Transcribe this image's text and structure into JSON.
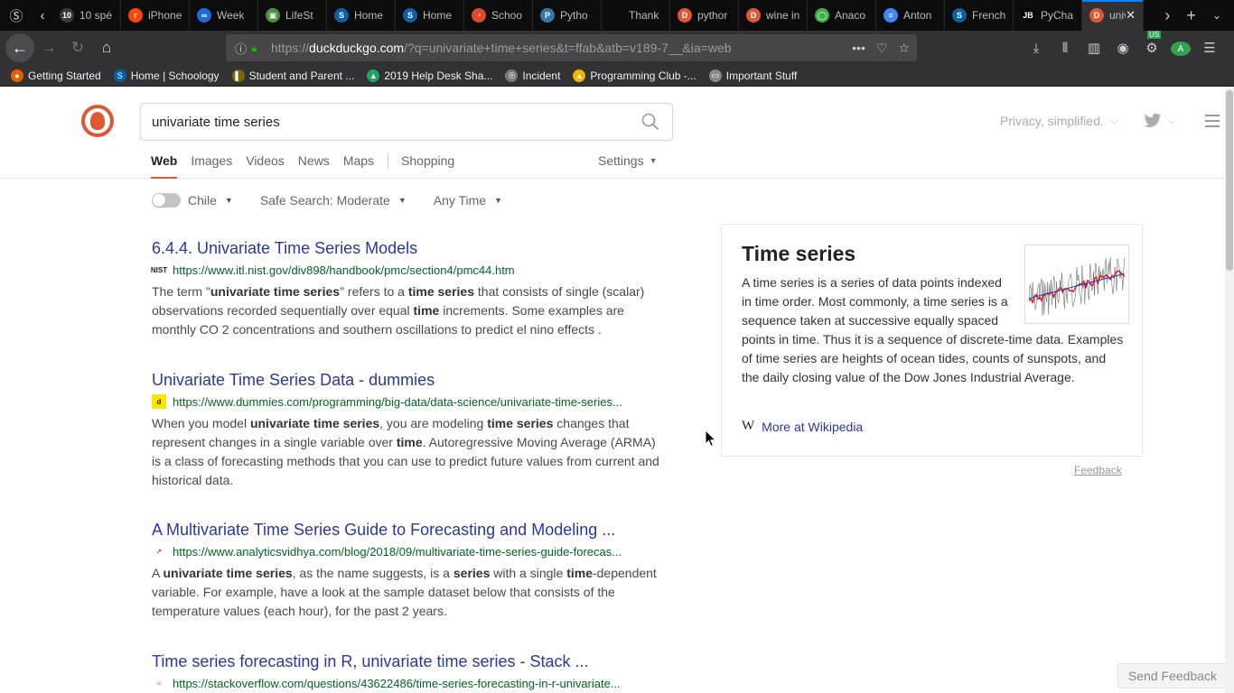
{
  "browser": {
    "tabs": [
      {
        "title": "10 spé",
        "color": "#3a3a3a",
        "glyph": "10"
      },
      {
        "title": "iPhone",
        "color": "#ff4500",
        "glyph": "r"
      },
      {
        "title": "Week",
        "color": "#1e6bd6",
        "glyph": "∞"
      },
      {
        "title": "LifeSt",
        "color": "#4a8f3a",
        "glyph": "▣"
      },
      {
        "title": "Home",
        "color": "#0b5fa5",
        "glyph": "S"
      },
      {
        "title": "Home",
        "color": "#0b5fa5",
        "glyph": "S"
      },
      {
        "title": "Schoo",
        "color": "#e0492c",
        "glyph": "◔"
      },
      {
        "title": "Pytho",
        "color": "#3776ab",
        "glyph": "P"
      },
      {
        "title": "Thank",
        "color": "#0c0c0d",
        "glyph": ""
      },
      {
        "title": "pythor",
        "color": "#de5833",
        "glyph": "D"
      },
      {
        "title": "wine in",
        "color": "#de5833",
        "glyph": "D"
      },
      {
        "title": "Anaco",
        "color": "#3eb049",
        "glyph": "◯"
      },
      {
        "title": "Anton",
        "color": "#4285f4",
        "glyph": "≡"
      },
      {
        "title": "French",
        "color": "#0b5fa5",
        "glyph": "S"
      },
      {
        "title": "PyCha",
        "color": "#000000",
        "glyph": "JB"
      }
    ],
    "active_tab": {
      "title": "univ",
      "color": "#de5833",
      "glyph": "D"
    },
    "url_prefix": "https://",
    "url_host": "duckduckgo.com",
    "url_rest": "/?q=univariate+time+series&t=ffab&atb=v189-7__&ia=web",
    "bookmarks": [
      {
        "label": "Getting Started",
        "color": "#e66000",
        "glyph": "●"
      },
      {
        "label": "Home | Schoology",
        "color": "#0b5fa5",
        "glyph": "S"
      },
      {
        "label": "Student and Parent ...",
        "color": "#7a6a00",
        "glyph": "▌"
      },
      {
        "label": "2019 Help Desk Sha...",
        "color": "#1fa463",
        "glyph": "▲"
      },
      {
        "label": "Incident",
        "color": "#777777",
        "glyph": "◎"
      },
      {
        "label": "Programming Club -...",
        "color": "#f4b400",
        "glyph": "▲"
      },
      {
        "label": "Important Stuff",
        "color": "#888888",
        "glyph": "▭"
      }
    ],
    "extension_badge": "US",
    "avatar_letter": "A"
  },
  "search": {
    "query": "univariate time series",
    "tagline": "Privacy, simplified."
  },
  "nav": {
    "tabs": [
      "Web",
      "Images",
      "Videos",
      "News",
      "Maps"
    ],
    "shopping": "Shopping",
    "settings": "Settings"
  },
  "filters": {
    "region": "Chile",
    "safe_search": "Safe Search: Moderate",
    "time": "Any Time"
  },
  "results": [
    {
      "title": "6.4.4. Univariate Time Series Models",
      "url": "https://www.itl.nist.gov/div898/handbook/pmc/section4/pmc44.htm",
      "favicon": "NIST",
      "snippet_html": "The term \"<b>univariate time series</b>\" refers to a <b>time series</b> that consists of single (scalar) observations recorded sequentially over equal <b>time</b> increments. Some examples are monthly CO 2 concentrations and southern oscillations to predict el nino effects ."
    },
    {
      "title": "Univariate Time Series Data - dummies",
      "url": "https://www.dummies.com/programming/big-data/data-science/univariate-time-series...",
      "favicon": "d",
      "snippet_html": "When you model <b>univariate time series</b>, you are modeling <b>time series</b> changes that represent changes in a single variable over <b>time</b>. Autoregressive Moving Average (ARMA) is a class of forecasting methods that you can use to predict future values from current and historical data."
    },
    {
      "title": "A Multivariate Time Series Guide to Forecasting and Modeling ...",
      "url": "https://www.analyticsvidhya.com/blog/2018/09/multivariate-time-series-guide-forecas...",
      "favicon": "↗",
      "snippet_html": "A <b>univariate time series</b>, as the name suggests, is a <b>series</b> with a single <b>time</b>-dependent variable. For example, have a look at the sample dataset below that consists of the temperature values (each hour), for the past 2 years."
    },
    {
      "title": "Time series forecasting in R, univariate time series - Stack ...",
      "url": "https://stackoverflow.com/questions/43622486/time-series-forecasting-in-r-univariate...",
      "favicon": "≡",
      "snippet_html": ""
    }
  ],
  "knowledge": {
    "title": "Time series",
    "text": "A time series is a series of data points indexed in time order. Most commonly, a time series is a sequence taken at successive equally spaced points in time. Thus it is a sequence of discrete-time data. Examples of time series are heights of ocean tides, counts of sunspots, and the daily closing value of the Dow Jones Industrial Average.",
    "more_link": "More at Wikipedia",
    "wiki_glyph": "W",
    "feedback": "Feedback"
  },
  "send_feedback": "Send Feedback",
  "colors": {
    "brand": "#de5833",
    "link": "#2b37a0",
    "url": "#006621"
  }
}
